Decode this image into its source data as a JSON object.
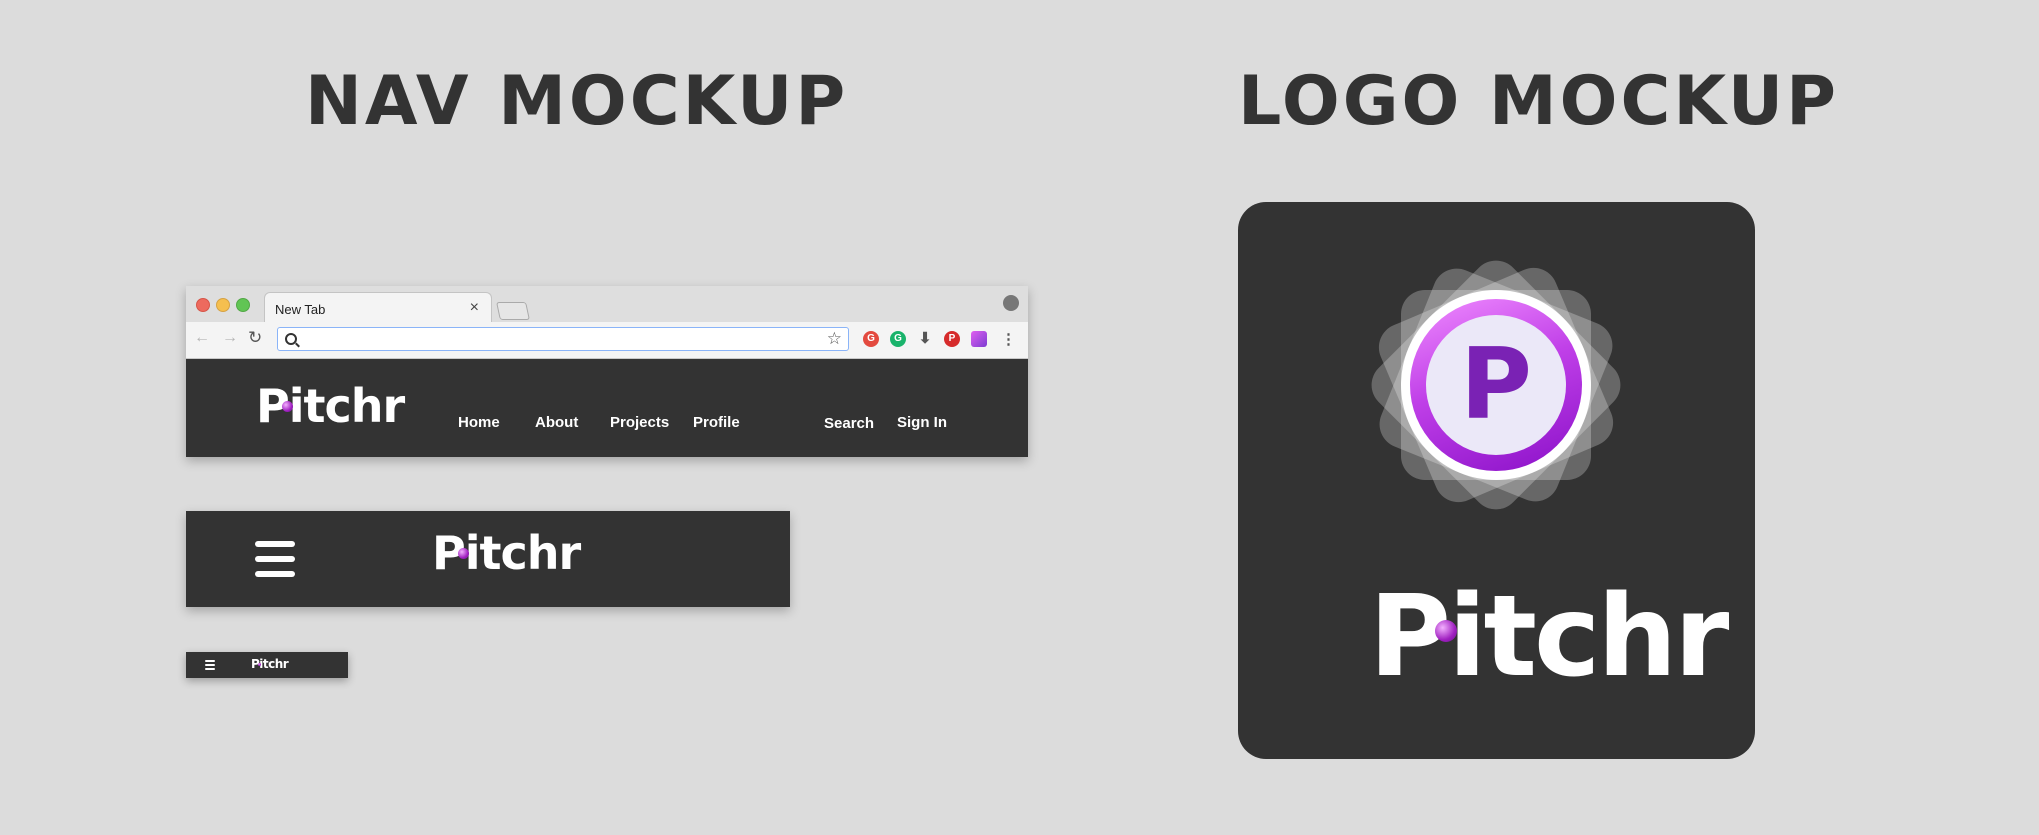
{
  "headings": {
    "nav": "NAV MOCKUP",
    "logo": "LOGO MOCKUP"
  },
  "browser": {
    "tab_title": "New Tab",
    "tab_close": "×",
    "back": "←",
    "forward": "→",
    "reload": "↻",
    "star": "☆",
    "menu": "⋮",
    "omnibox_value": "",
    "extensions": [
      {
        "icon": "grammar-extension-icon",
        "glyph": "G"
      },
      {
        "icon": "grammarly-extension-icon",
        "glyph": "G"
      },
      {
        "icon": "download-extension-icon",
        "glyph": "⬇"
      },
      {
        "icon": "pinterest-extension-icon",
        "glyph": "P"
      },
      {
        "icon": "pitchr-extension-icon",
        "glyph": ""
      }
    ]
  },
  "brand": {
    "first_letter": "P",
    "rest": "itchr",
    "badge_letter": "P",
    "accent": "#a020c0",
    "nav_bg": "#333333"
  },
  "nav": {
    "links": [
      "Home",
      "About",
      "Projects",
      "Profile"
    ],
    "search": "Search",
    "sign_in": "Sign In"
  }
}
